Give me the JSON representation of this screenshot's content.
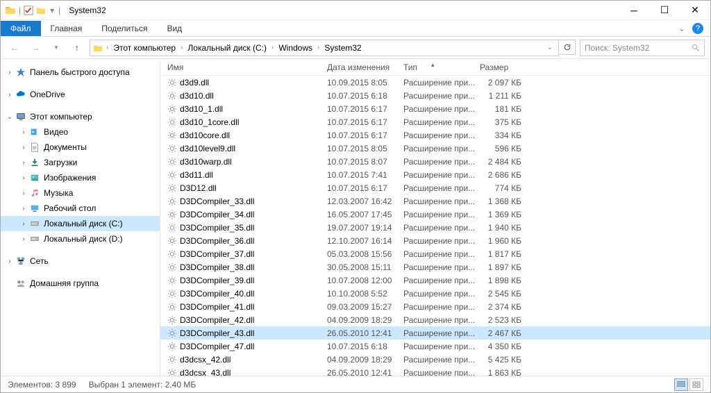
{
  "window": {
    "title": "System32"
  },
  "ribbon": {
    "file": "Файл",
    "tabs": [
      "Главная",
      "Поделиться",
      "Вид"
    ]
  },
  "breadcrumb": [
    "Этот компьютер",
    "Локальный диск (C:)",
    "Windows",
    "System32"
  ],
  "search": {
    "placeholder": "Поиск: System32"
  },
  "nav": {
    "quick": "Панель быстрого доступа",
    "onedrive": "OneDrive",
    "thispc": "Этот компьютер",
    "thispc_items": [
      {
        "label": "Видео",
        "icon": "video"
      },
      {
        "label": "Документы",
        "icon": "doc"
      },
      {
        "label": "Загрузки",
        "icon": "download"
      },
      {
        "label": "Изображения",
        "icon": "image"
      },
      {
        "label": "Музыка",
        "icon": "music"
      },
      {
        "label": "Рабочий стол",
        "icon": "desktop"
      },
      {
        "label": "Локальный диск (C:)",
        "icon": "drive",
        "selected": true
      },
      {
        "label": "Локальный диск (D:)",
        "icon": "drive"
      }
    ],
    "network": "Сеть",
    "homegroup": "Домашняя группа"
  },
  "columns": {
    "name": "Имя",
    "date": "Дата изменения",
    "type": "Тип",
    "size": "Размер"
  },
  "files": [
    {
      "name": "d3d9.dll",
      "date": "10.09.2015 8:05",
      "type": "Расширение при...",
      "size": "2 097 КБ"
    },
    {
      "name": "d3d10.dll",
      "date": "10.07.2015 6:18",
      "type": "Расширение при...",
      "size": "1 211 КБ"
    },
    {
      "name": "d3d10_1.dll",
      "date": "10.07.2015 6:17",
      "type": "Расширение при...",
      "size": "181 КБ"
    },
    {
      "name": "d3d10_1core.dll",
      "date": "10.07.2015 6:17",
      "type": "Расширение при...",
      "size": "375 КБ"
    },
    {
      "name": "d3d10core.dll",
      "date": "10.07.2015 6:17",
      "type": "Расширение при...",
      "size": "334 КБ"
    },
    {
      "name": "d3d10level9.dll",
      "date": "10.07.2015 8:05",
      "type": "Расширение при...",
      "size": "596 КБ"
    },
    {
      "name": "d3d10warp.dll",
      "date": "10.07.2015 8:07",
      "type": "Расширение при...",
      "size": "2 484 КБ"
    },
    {
      "name": "d3d11.dll",
      "date": "10.07.2015 7:41",
      "type": "Расширение при...",
      "size": "2 686 КБ"
    },
    {
      "name": "D3D12.dll",
      "date": "10.07.2015 6:17",
      "type": "Расширение при...",
      "size": "774 КБ"
    },
    {
      "name": "D3DCompiler_33.dll",
      "date": "12.03.2007 16:42",
      "type": "Расширение при...",
      "size": "1 368 КБ"
    },
    {
      "name": "D3DCompiler_34.dll",
      "date": "16.05.2007 17:45",
      "type": "Расширение при...",
      "size": "1 369 КБ"
    },
    {
      "name": "D3DCompiler_35.dll",
      "date": "19.07.2007 19:14",
      "type": "Расширение при...",
      "size": "1 940 КБ"
    },
    {
      "name": "D3DCompiler_36.dll",
      "date": "12.10.2007 16:14",
      "type": "Расширение при...",
      "size": "1 960 КБ"
    },
    {
      "name": "D3DCompiler_37.dll",
      "date": "05.03.2008 15:56",
      "type": "Расширение при...",
      "size": "1 817 КБ"
    },
    {
      "name": "D3DCompiler_38.dll",
      "date": "30.05.2008 15:11",
      "type": "Расширение при...",
      "size": "1 897 КБ"
    },
    {
      "name": "D3DCompiler_39.dll",
      "date": "10.07.2008 12:00",
      "type": "Расширение при...",
      "size": "1 898 КБ"
    },
    {
      "name": "D3DCompiler_40.dll",
      "date": "10.10.2008 5:52",
      "type": "Расширение при...",
      "size": "2 545 КБ"
    },
    {
      "name": "D3DCompiler_41.dll",
      "date": "09.03.2009 15:27",
      "type": "Расширение при...",
      "size": "2 374 КБ"
    },
    {
      "name": "D3DCompiler_42.dll",
      "date": "04.09.2009 18:29",
      "type": "Расширение при...",
      "size": "2 523 КБ"
    },
    {
      "name": "D3DCompiler_43.dll",
      "date": "26.05.2010 12:41",
      "type": "Расширение при...",
      "size": "2 467 КБ",
      "selected": true
    },
    {
      "name": "D3DCompiler_47.dll",
      "date": "10.07.2015 6:18",
      "type": "Расширение при...",
      "size": "4 350 КБ"
    },
    {
      "name": "d3dcsx_42.dll",
      "date": "04.09.2009 18:29",
      "type": "Расширение при...",
      "size": "5 425 КБ"
    },
    {
      "name": "d3dcsx_43.dll",
      "date": "26.05.2010 12:41",
      "type": "Расширение при...",
      "size": "1 863 КБ"
    }
  ],
  "status": {
    "count": "Элементов: 3 899",
    "selected": "Выбран 1 элемент: 2,40 МБ"
  }
}
